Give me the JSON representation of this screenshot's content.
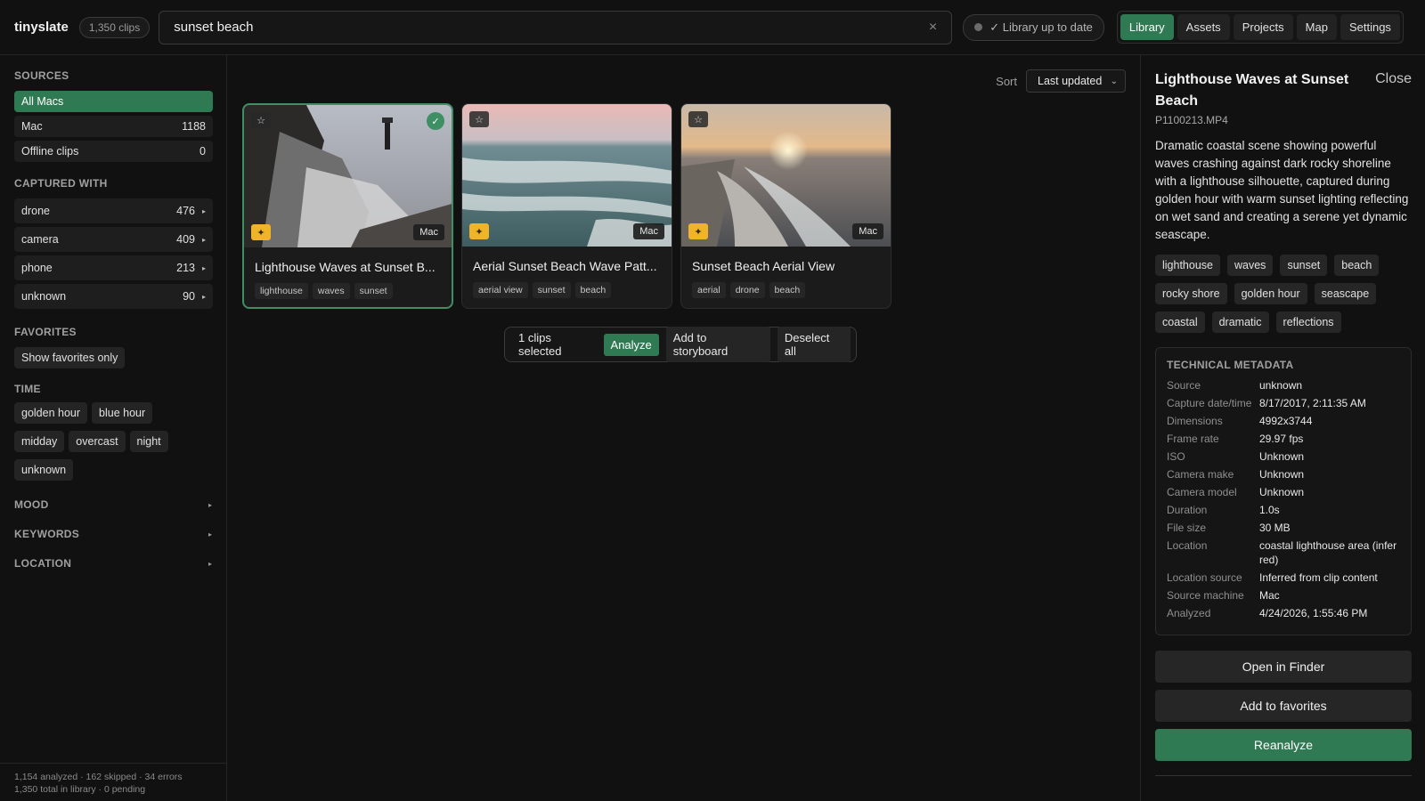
{
  "app": {
    "name": "tinyslate",
    "clip_count": "1,350 clips"
  },
  "search": {
    "value": "sunset beach",
    "clear_icon": "×"
  },
  "status": {
    "text": "✓ Library up to date"
  },
  "nav": {
    "tabs": [
      "Library",
      "Assets",
      "Projects",
      "Map",
      "Settings"
    ],
    "active": "Library"
  },
  "sidebar": {
    "sources_title": "SOURCES",
    "sources": [
      {
        "label": "All Macs",
        "count": ""
      },
      {
        "label": "Mac",
        "count": "1188"
      },
      {
        "label": "Offline clips",
        "count": "0"
      }
    ],
    "captured_title": "CAPTURED WITH",
    "captured": [
      {
        "label": "drone",
        "count": "476"
      },
      {
        "label": "camera",
        "count": "409"
      },
      {
        "label": "phone",
        "count": "213"
      },
      {
        "label": "unknown",
        "count": "90"
      }
    ],
    "favorites_title": "FAVORITES",
    "favorites_button": "Show favorites only",
    "time_title": "TIME",
    "time_chips": [
      "golden hour",
      "blue hour",
      "midday",
      "overcast",
      "night",
      "unknown"
    ],
    "mood_title": "MOOD",
    "keywords_title": "KEYWORDS",
    "location_title": "LOCATION",
    "footer_line1": "1,154 analyzed · 162 skipped · 34 errors",
    "footer_line2": "1,350 total in library · 0 pending"
  },
  "sort": {
    "label": "Sort",
    "value": "Last updated"
  },
  "cards": [
    {
      "title": "Lighthouse Waves at Sunset B...",
      "tags": [
        "lighthouse",
        "waves",
        "sunset"
      ],
      "badge": "Mac",
      "selected": true
    },
    {
      "title": "Aerial Sunset Beach Wave Patt...",
      "tags": [
        "aerial view",
        "sunset",
        "beach"
      ],
      "badge": "Mac",
      "selected": false
    },
    {
      "title": "Sunset Beach Aerial View",
      "tags": [
        "aerial",
        "drone",
        "beach"
      ],
      "badge": "Mac",
      "selected": false
    }
  ],
  "selection": {
    "text": "1 clips selected",
    "analyze": "Analyze",
    "add_storyboard": "Add to storyboard",
    "deselect": "Deselect all"
  },
  "detail": {
    "title": "Lighthouse Waves at Sunset Beach",
    "close": "Close",
    "filename": "P1100213.MP4",
    "description": "Dramatic coastal scene showing powerful waves crashing against dark rocky shoreline with a lighthouse silhouette, captured during golden hour with warm sunset lighting reflecting on wet sand and creating a serene yet dynamic seascape.",
    "tags": [
      "lighthouse",
      "waves",
      "sunset",
      "beach",
      "rocky shore",
      "golden hour",
      "seascape",
      "coastal",
      "dramatic",
      "reflections"
    ],
    "meta_title": "TECHNICAL METADATA",
    "metadata": [
      {
        "key": "Source",
        "value": "unknown"
      },
      {
        "key": "Capture date/time",
        "value": "8/17/2017, 2:11:35 AM"
      },
      {
        "key": "Dimensions",
        "value": "4992x3744"
      },
      {
        "key": "Frame rate",
        "value": "29.97 fps"
      },
      {
        "key": "ISO",
        "value": "Unknown"
      },
      {
        "key": "Camera make",
        "value": "Unknown"
      },
      {
        "key": "Camera model",
        "value": "Unknown"
      },
      {
        "key": "Duration",
        "value": "1.0s"
      },
      {
        "key": "File size",
        "value": "30 MB"
      },
      {
        "key": "Location",
        "value": "coastal lighthouse area (inferred)"
      },
      {
        "key": "Location source",
        "value": "Inferred from clip content"
      },
      {
        "key": "Source machine",
        "value": "Mac"
      },
      {
        "key": "Analyzed",
        "value": "4/24/2026, 1:55:46 PM"
      }
    ],
    "open_finder": "Open in Finder",
    "add_favorites": "Add to favorites",
    "reanalyze": "Reanalyze"
  },
  "colors": {
    "accent": "#2f7a52",
    "spark": "#f0b429",
    "background": "#111111"
  }
}
